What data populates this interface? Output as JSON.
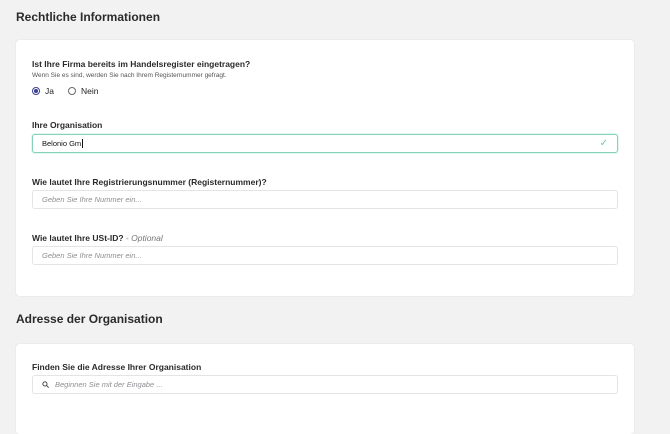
{
  "legal": {
    "title": "Rechtliche Informationen",
    "registered_question": "Ist Ihre Firma bereits im Handelsregister eingetragen?",
    "registered_hint": "Wenn Sie es sind, werden Sie nach Ihrem Registernummer gefragt.",
    "options": [
      {
        "label": "Ja",
        "checked": true
      },
      {
        "label": "Nein",
        "checked": false
      }
    ],
    "org_label": "Ihre Organisation",
    "org_value": "Belonio Gm",
    "regnum_label": "Wie lautet Ihre Registrierungsnummer (Registernummer)?",
    "regnum_placeholder": "Geben Sie Ihre Nummer ein...",
    "vat_label": "Wie lautet Ihre USt-ID?",
    "vat_optional": " - Optional",
    "vat_placeholder": "Geben Sie Ihre Nummer ein..."
  },
  "address": {
    "title": "Adresse der Organisation",
    "find_label": "Finden Sie die Adresse Ihrer Organisation",
    "search_placeholder": "Beginnen Sie mit der Eingabe ..."
  },
  "icons": {
    "valid": "check-icon",
    "search": "search-icon"
  },
  "colors": {
    "accent": "#3c3f8f",
    "valid_border": "#86d3b8",
    "valid_check": "#6fc9a6"
  }
}
